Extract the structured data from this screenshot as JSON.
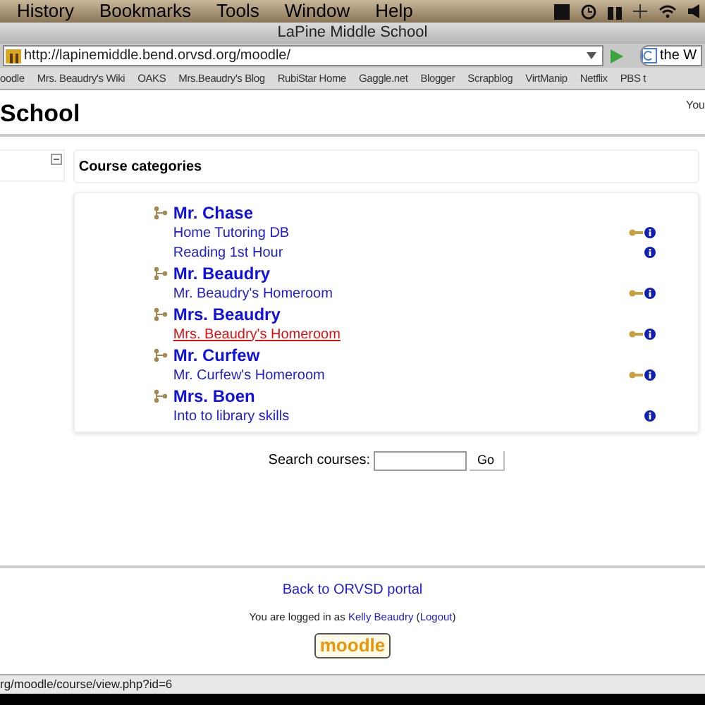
{
  "menu_bar": [
    "History",
    "Bookmarks",
    "Tools",
    "Window",
    "Help"
  ],
  "window": {
    "title": "LaPine Middle School"
  },
  "address_bar": {
    "value": "http://lapinemiddle.bend.orvsd.org/moodle/"
  },
  "search_box": {
    "value": "the W"
  },
  "bookmarks": [
    "oodle",
    "Mrs. Beaudry's Wiki",
    "OAKS",
    "Mrs.Beaudry's Blog",
    "RubiStar Home",
    "Gaggle.net",
    "Blogger",
    "Scrapblog",
    "VirtManip",
    "Netflix",
    "PBS t"
  ],
  "page": {
    "heading": "School",
    "header_right": "You",
    "course_categories": {
      "title": "Course categories",
      "categories": [
        {
          "name": "Mr. Chase",
          "courses": [
            {
              "name": "Home Tutoring DB",
              "key": true,
              "hovered": false
            },
            {
              "name": "Reading 1st Hour",
              "key": false,
              "hovered": false
            }
          ]
        },
        {
          "name": "Mr. Beaudry",
          "courses": [
            {
              "name": "Mr. Beaudry's Homeroom",
              "key": true,
              "hovered": false
            }
          ]
        },
        {
          "name": "Mrs. Beaudry",
          "courses": [
            {
              "name": "Mrs. Beaudry's Homeroom",
              "key": true,
              "hovered": true
            }
          ]
        },
        {
          "name": "Mr. Curfew",
          "courses": [
            {
              "name": "Mr. Curfew's Homeroom",
              "key": true,
              "hovered": false
            }
          ]
        },
        {
          "name": "Mrs. Boen",
          "courses": [
            {
              "name": "Into to library skills",
              "key": false,
              "hovered": false
            }
          ]
        }
      ]
    },
    "search": {
      "label": "Search courses:",
      "button": "Go"
    },
    "footer": {
      "portal_link": "Back to ORVSD portal",
      "login_prefix": "You are logged in as ",
      "user": "Kelly Beaudry",
      "logout_open": " (",
      "logout": "Logout",
      "logout_close": ")",
      "logo": "moodle"
    }
  },
  "status_bar": "rg/moodle/course/view.php?id=6"
}
